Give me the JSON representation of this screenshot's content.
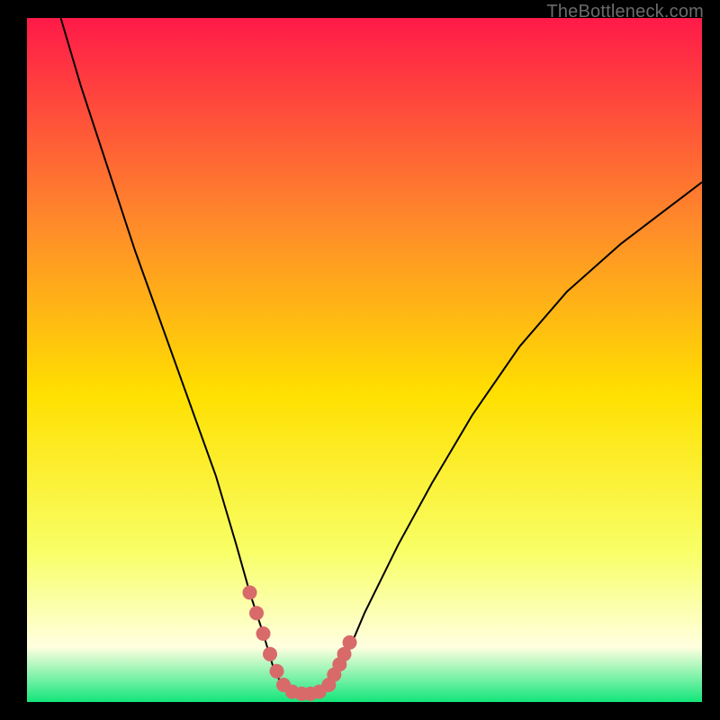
{
  "watermark": "TheBottleneck.com",
  "chart_data": {
    "type": "line",
    "title": "",
    "xlabel": "",
    "ylabel": "",
    "xlim": [
      0,
      100
    ],
    "ylim": [
      0,
      100
    ],
    "grid": false,
    "legend": false,
    "background_gradient": {
      "top_color": "#ff1a49",
      "mid_upper_color": "#ff8a2a",
      "mid_color": "#ffe000",
      "mid_lower_color": "#f8ff66",
      "near_bottom_color": "#ffffe0",
      "bottom_color": "#12e67a"
    },
    "series": [
      {
        "name": "bottleneck-curve",
        "color": "#000000",
        "x": [
          5,
          8,
          12,
          16,
          20,
          24,
          28,
          31,
          33,
          35,
          36.5,
          38,
          40,
          42,
          44,
          47,
          50,
          55,
          60,
          66,
          73,
          80,
          88,
          96,
          100
        ],
        "y": [
          100,
          90,
          78,
          66,
          55,
          44,
          33,
          23,
          16,
          10,
          5,
          2,
          1,
          1,
          2,
          6,
          13,
          23,
          32,
          42,
          52,
          60,
          67,
          73,
          76
        ]
      },
      {
        "name": "highlight-dots",
        "color": "#d86a6a",
        "type": "scatter",
        "x": [
          33.0,
          34.0,
          35.0,
          36.0,
          37.0,
          38.0,
          39.3,
          40.7,
          42.0,
          43.3,
          44.7,
          45.5,
          46.3,
          47.0,
          47.8
        ],
        "y": [
          16.0,
          13.0,
          10.0,
          7.0,
          4.5,
          2.5,
          1.5,
          1.2,
          1.2,
          1.5,
          2.5,
          4.0,
          5.5,
          7.0,
          8.7
        ]
      }
    ]
  }
}
